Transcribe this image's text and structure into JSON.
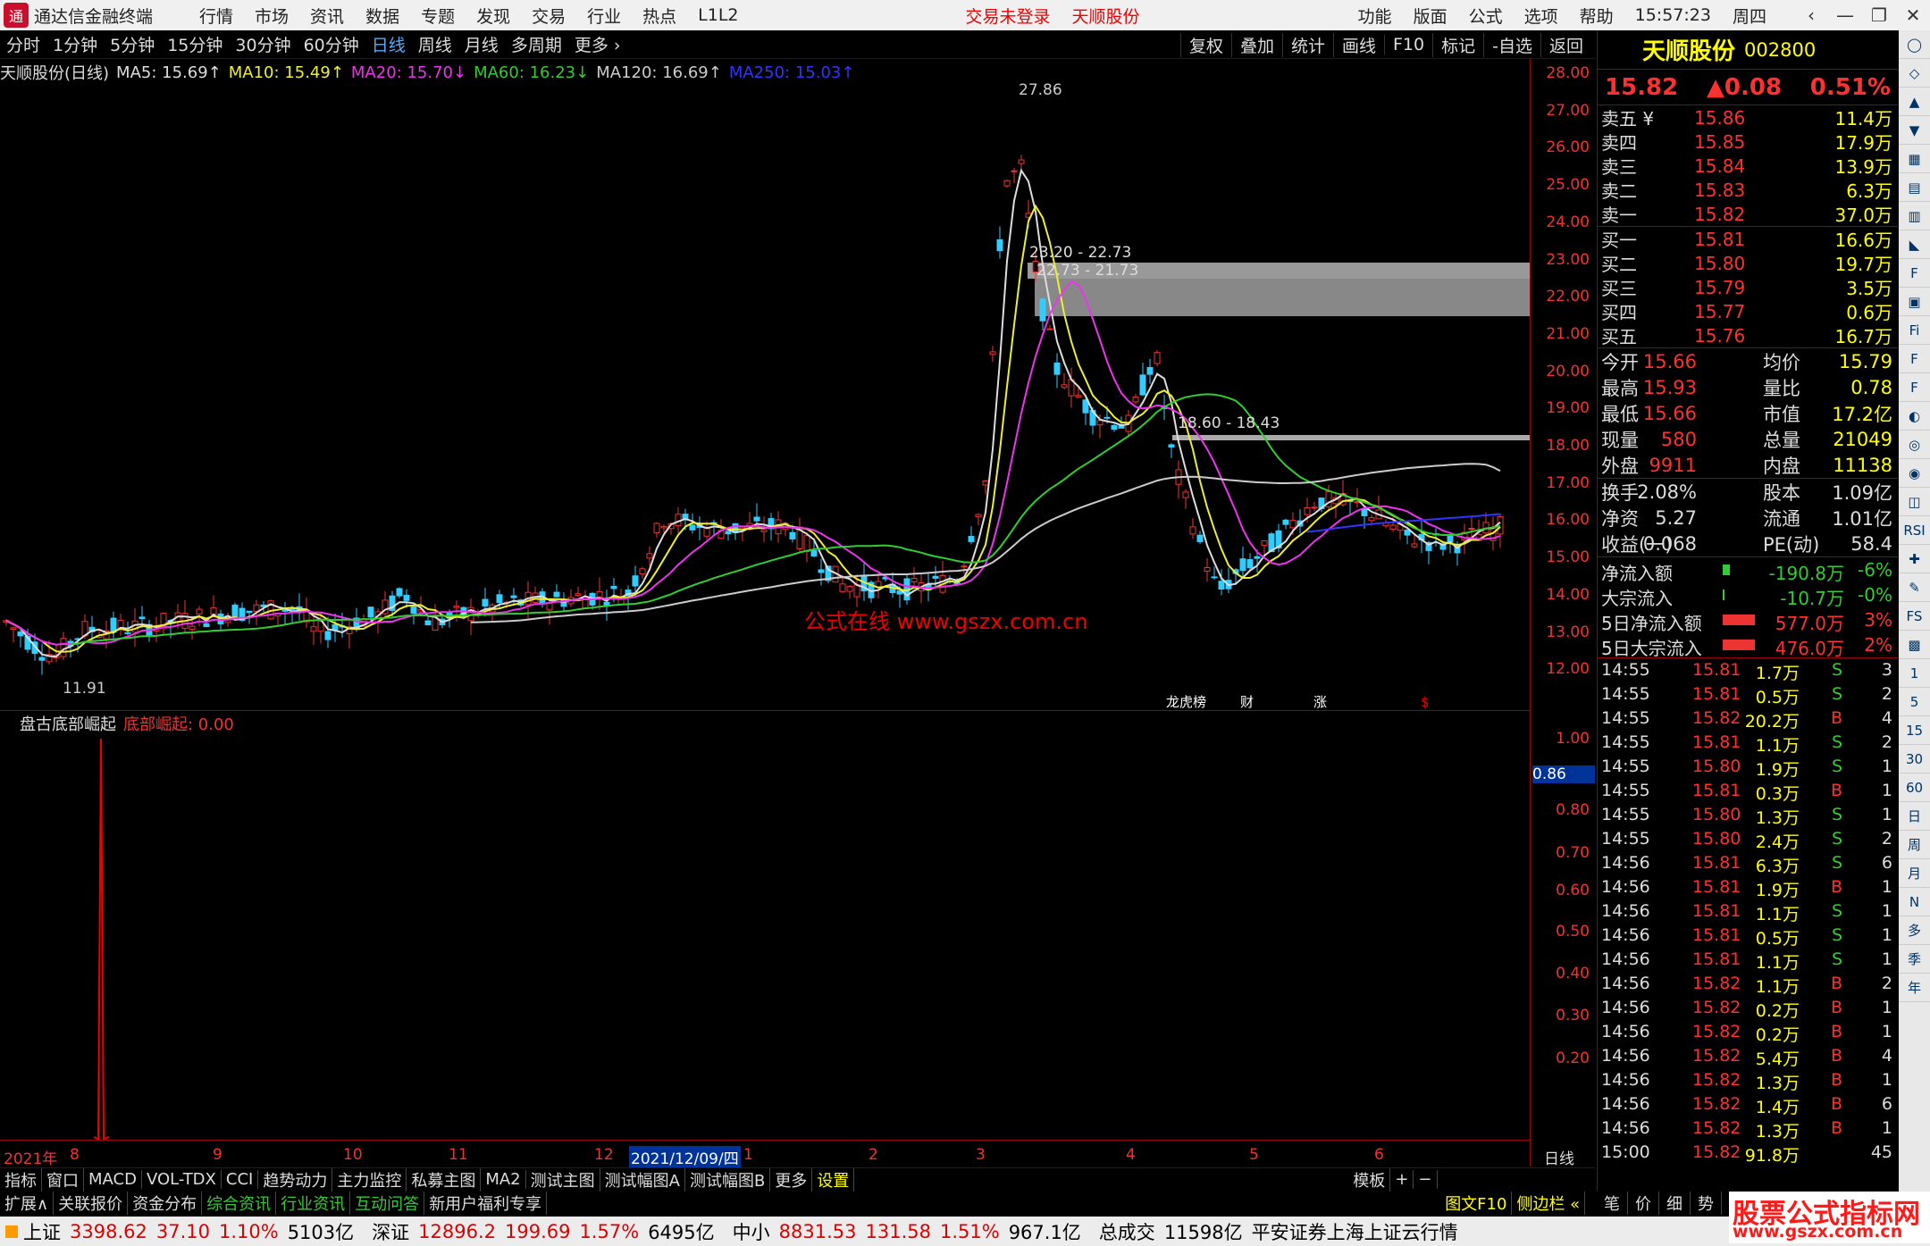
{
  "menubar": {
    "app_title": "通达信金融终端",
    "items": [
      "行情",
      "市场",
      "资讯",
      "数据",
      "专题",
      "发现",
      "交易",
      "行业",
      "热点",
      "L1L2"
    ],
    "trade_status": "交易未登录",
    "stock_name": "天顺股份",
    "right_items": [
      "功能",
      "版面",
      "公式",
      "选项",
      "帮助"
    ],
    "time": "15:57:23",
    "weekday": "周四",
    "controls": [
      "‹",
      "—",
      "❐",
      "✕"
    ]
  },
  "periodbar": {
    "items": [
      "分时",
      "1分钟",
      "5分钟",
      "15分钟",
      "30分钟",
      "60分钟",
      "日线",
      "周线",
      "月线",
      "多周期",
      "更多 ›"
    ],
    "active": "日线",
    "tools": [
      "复权",
      "叠加",
      "统计",
      "画线",
      "F10",
      "标记",
      "-自选",
      "返回"
    ]
  },
  "legend": {
    "title": "天顺股份(日线)",
    "ma5": "MA5: 15.69↑",
    "ma10": "MA10: 15.49↑",
    "ma20": "MA20: 15.70↓",
    "ma60": "MA60: 16.23↓",
    "ma120": "MA120: 16.69↑",
    "ma250": "MA250: 15.03↑"
  },
  "axis_ticks": [
    "28.00",
    "27.00",
    "26.00",
    "25.00",
    "24.00",
    "23.00",
    "22.00",
    "21.00",
    "20.00",
    "19.00",
    "18.00",
    "17.00",
    "16.00",
    "15.00",
    "14.00",
    "13.00",
    "12.00"
  ],
  "sub_ticks": [
    "1.00",
    "0.86",
    "0.80",
    "0.70",
    "0.60",
    "0.50",
    "0.40",
    "0.30",
    "0.20"
  ],
  "annotations": {
    "high": "27.86",
    "low": "11.91",
    "box1a": "23.20 - 22.73",
    "box1b": "22.73 - 21.73",
    "box2": "18.60 - 18.43",
    "watermark": "公式在线 www.gszx.com.cn",
    "markers": [
      "龙虎榜",
      "财",
      "涨",
      "$"
    ]
  },
  "indicator": {
    "name": "盘古底部崛起",
    "label": "底部崛起: 0.00"
  },
  "dates": [
    "2021年",
    "8",
    "9",
    "10",
    "11",
    "12",
    "2021/12/09/四",
    "1",
    "2",
    "3",
    "4",
    "5",
    "6",
    "日线"
  ],
  "tabs": [
    "指标",
    "窗口",
    "MACD",
    "VOL-TDX",
    "CCI",
    "趋势动力",
    "主力监控",
    "私募主图",
    "MA2",
    "测试主图",
    "测试幅图A",
    "测试幅图B",
    "更多",
    "设置",
    "模板",
    "+",
    "−"
  ],
  "extbar": [
    "扩展∧",
    "关联报价",
    "资金分布",
    "综合资讯",
    "行业资讯",
    "互动问答",
    "新用户福利专享",
    "图文F10",
    "侧边栏 «"
  ],
  "right": {
    "name": "天顺股份",
    "code": "002800",
    "price": "15.82",
    "change": "▲0.08",
    "pct": "0.51%",
    "asks": [
      [
        "卖五 ¥",
        "15.86",
        "11.4万"
      ],
      [
        "卖四",
        "15.85",
        "17.9万"
      ],
      [
        "卖三",
        "15.84",
        "13.9万"
      ],
      [
        "卖二",
        "15.83",
        "6.3万"
      ],
      [
        "卖一",
        "15.82",
        "37.0万"
      ]
    ],
    "bids": [
      [
        "买一",
        "15.81",
        "16.6万"
      ],
      [
        "买二",
        "15.80",
        "19.7万"
      ],
      [
        "买三",
        "15.79",
        "3.5万"
      ],
      [
        "买四",
        "15.77",
        "0.6万"
      ],
      [
        "买五",
        "15.76",
        "16.7万"
      ]
    ],
    "stats": [
      [
        "今开",
        "15.66",
        "均价",
        "15.79"
      ],
      [
        "最高",
        "15.93",
        "量比",
        "0.78"
      ],
      [
        "最低",
        "15.66",
        "市值",
        "17.2亿"
      ],
      [
        "现量",
        "580",
        "总量",
        "21049"
      ],
      [
        "外盘",
        "9911",
        "内盘",
        "11138"
      ]
    ],
    "stats2": [
      [
        "换手",
        "2.08%",
        "股本",
        "1.09亿"
      ],
      [
        "净资",
        "5.27",
        "流通",
        "1.01亿"
      ],
      [
        "收益(一)",
        "0.068",
        "PE(动)",
        "58.4"
      ]
    ],
    "flows": [
      [
        "净流入额",
        "-190.8万",
        "-6%"
      ],
      [
        "大宗流入",
        "-10.7万",
        "-0%"
      ],
      [
        "5日净流入额",
        "577.0万",
        "3%"
      ],
      [
        "5日大宗流入",
        "476.0万",
        "2%"
      ]
    ],
    "ticks": [
      [
        "14:55",
        "15.81",
        "1.7万",
        "S",
        "3"
      ],
      [
        "14:55",
        "15.81",
        "0.5万",
        "S",
        "2"
      ],
      [
        "14:55",
        "15.82",
        "20.2万",
        "B",
        "4"
      ],
      [
        "14:55",
        "15.81",
        "1.1万",
        "S",
        "2"
      ],
      [
        "14:55",
        "15.80",
        "1.9万",
        "S",
        "1"
      ],
      [
        "14:55",
        "15.81",
        "0.3万",
        "B",
        "1"
      ],
      [
        "14:55",
        "15.80",
        "1.3万",
        "S",
        "1"
      ],
      [
        "14:55",
        "15.80",
        "2.4万",
        "S",
        "2"
      ],
      [
        "14:56",
        "15.81",
        "6.3万",
        "S",
        "6"
      ],
      [
        "14:56",
        "15.81",
        "1.9万",
        "B",
        "1"
      ],
      [
        "14:56",
        "15.81",
        "1.1万",
        "S",
        "1"
      ],
      [
        "14:56",
        "15.81",
        "0.5万",
        "S",
        "1"
      ],
      [
        "14:56",
        "15.81",
        "1.1万",
        "S",
        "1"
      ],
      [
        "14:56",
        "15.82",
        "1.1万",
        "B",
        "2"
      ],
      [
        "14:56",
        "15.82",
        "0.2万",
        "B",
        "1"
      ],
      [
        "14:56",
        "15.82",
        "0.2万",
        "B",
        "1"
      ],
      [
        "14:56",
        "15.82",
        "5.4万",
        "B",
        "4"
      ],
      [
        "14:56",
        "15.82",
        "1.3万",
        "B",
        "1"
      ],
      [
        "14:56",
        "15.82",
        "1.4万",
        "B",
        "6"
      ],
      [
        "14:56",
        "15.82",
        "1.3万",
        "B",
        "1"
      ],
      [
        "15:00",
        "15.82",
        "91.8万",
        "",
        "45"
      ]
    ],
    "bottom_tabs": [
      "笔",
      "价",
      "细",
      "势"
    ]
  },
  "sidebar": [
    "◯",
    "◇",
    "▲",
    "▼",
    "▦",
    "▤",
    "▥",
    "◣",
    "F",
    "▣",
    "Fi",
    "F",
    "F",
    "◐",
    "◎",
    "◉",
    "◫",
    "RSI",
    "✚",
    "✎",
    "FS",
    "▩",
    "1",
    "5",
    "15",
    "30",
    "60",
    "日",
    "周",
    "月",
    "N",
    "多",
    "季",
    "年"
  ],
  "status": {
    "sh_label": "上证",
    "sh": "3398.62",
    "sh_chg": "37.10",
    "sh_pct": "1.10%",
    "sh_amt": "5103亿",
    "sz_label": "深证",
    "sz": "12896.2",
    "sz_chg": "199.69",
    "sz_pct": "1.57%",
    "sz_amt": "6495亿",
    "zx_label": "中小",
    "zx": "8831.53",
    "zx_chg": "131.58",
    "zx_pct": "1.51%",
    "zx_amt": "967.1亿",
    "total_label": "总成交",
    "total": "11598亿",
    "broker": "平安证券上海上证云行情"
  },
  "brand": {
    "line1": "股票公式指标网",
    "line2": "www.gszx.com.cn"
  }
}
